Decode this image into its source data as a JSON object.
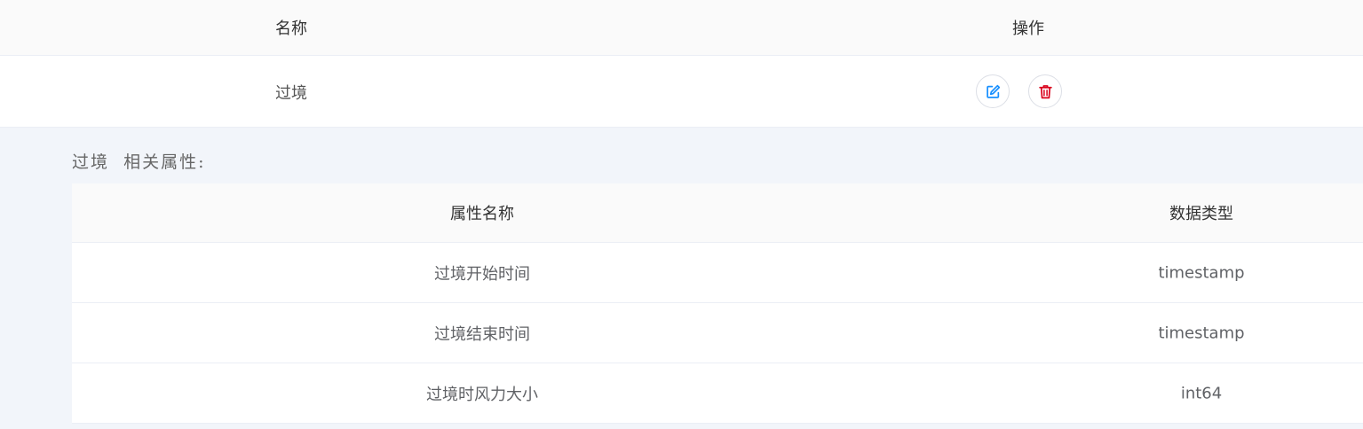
{
  "main_table": {
    "headers": {
      "name": "名称",
      "operations": "操作"
    },
    "rows": [
      {
        "name": "过境"
      }
    ]
  },
  "icons": {
    "edit": "edit-icon",
    "delete": "delete-icon"
  },
  "colors": {
    "edit_icon": "#1890ff",
    "delete_icon": "#d9001b"
  },
  "expand": {
    "title": "过境  相关属性:",
    "sub_table": {
      "headers": {
        "attr_name": "属性名称",
        "data_type": "数据类型"
      },
      "rows": [
        {
          "attr_name": "过境开始时间",
          "data_type": "timestamp"
        },
        {
          "attr_name": "过境结束时间",
          "data_type": "timestamp"
        },
        {
          "attr_name": "过境时风力大小",
          "data_type": "int64"
        }
      ]
    }
  }
}
